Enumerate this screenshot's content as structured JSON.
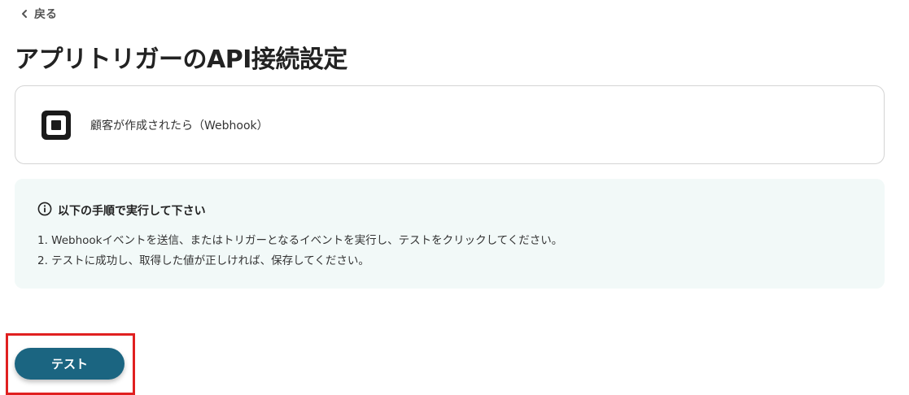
{
  "nav": {
    "back_label": "戻る",
    "back_icon": "chevron-left-icon"
  },
  "page": {
    "title": "アプリトリガーのAPI接続設定"
  },
  "trigger": {
    "app_icon": "square-logo-icon",
    "label": "顧客が作成されたら（Webhook）"
  },
  "instructions": {
    "icon": "info-icon",
    "heading": "以下の手順で実行して下さい",
    "steps": [
      "1. Webhookイベントを送信、またはトリガーとなるイベントを実行し、テストをクリックしてください。",
      "2. テストに成功し、取得した値が正しければ、保存してください。"
    ]
  },
  "actions": {
    "test_label": "テスト"
  },
  "colors": {
    "primary_button": "#1b6581",
    "info_background": "#f2f9f8",
    "highlight_frame": "#e02020"
  }
}
